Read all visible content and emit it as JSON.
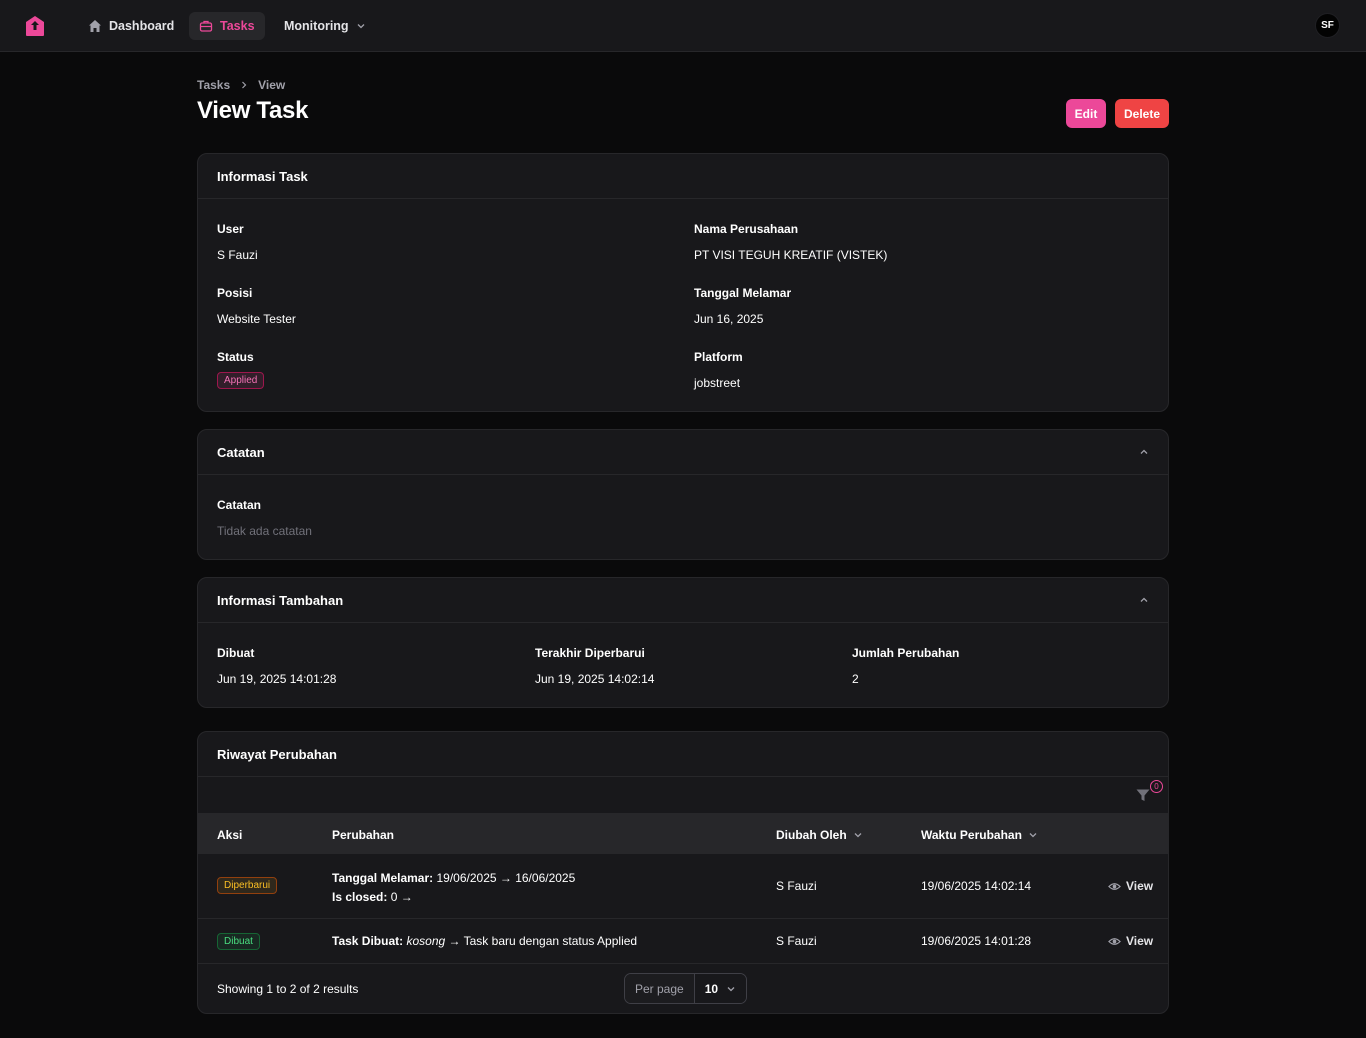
{
  "nav": {
    "items": [
      {
        "label": "Dashboard",
        "icon": "home-icon"
      },
      {
        "label": "Tasks",
        "icon": "briefcase-icon"
      },
      {
        "label": "Monitoring",
        "icon": "chevron-down-icon"
      }
    ],
    "avatar": "SF",
    "accent": "#ec4899"
  },
  "breadcrumb": [
    "Tasks",
    "View"
  ],
  "page": {
    "title": "View Task",
    "edit_label": "Edit",
    "delete_label": "Delete"
  },
  "info": {
    "title": "Informasi Task",
    "user_label": "User",
    "user": "S Fauzi",
    "company_label": "Nama Perusahaan",
    "company": "PT VISI TEGUH KREATIF (VISTEK)",
    "position_label": "Posisi",
    "position": "Website Tester",
    "applied_date_label": "Tanggal Melamar",
    "applied_date": "Jun 16, 2025",
    "status_label": "Status",
    "status": "Applied",
    "platform_label": "Platform",
    "platform": "jobstreet"
  },
  "notes": {
    "title": "Catatan",
    "label": "Catatan",
    "value": "Tidak ada catatan"
  },
  "extra": {
    "title": "Informasi Tambahan",
    "created_label": "Dibuat",
    "created": "Jun 19, 2025 14:01:28",
    "updated_label": "Terakhir Diperbarui",
    "updated": "Jun 19, 2025 14:02:14",
    "changes_label": "Jumlah Perubahan",
    "changes": "2"
  },
  "history": {
    "title": "Riwayat Perubahan",
    "filter_count": "0",
    "columns": [
      "Aksi",
      "Perubahan",
      "Diubah Oleh",
      "Waktu Perubahan"
    ],
    "rows": [
      {
        "action": "Diperbarui",
        "change1_key": "Tanggal Melamar:",
        "change1_val": "19/06/2025 → 16/06/2025",
        "change2_key": "Is closed:",
        "change2_val": "0 →",
        "by": "S Fauzi",
        "time": "19/06/2025 14:02:14",
        "view": "View"
      },
      {
        "action": "Dibuat",
        "change1_key": "Task Dibuat:",
        "change1_em": "kosong",
        "change1_val": "→ Task baru dengan status Applied",
        "by": "S Fauzi",
        "time": "19/06/2025 14:01:28",
        "view": "View"
      }
    ],
    "summary": "Showing 1 to 2 of 2 results",
    "per_page_label": "Per page",
    "per_page_value": "10"
  }
}
